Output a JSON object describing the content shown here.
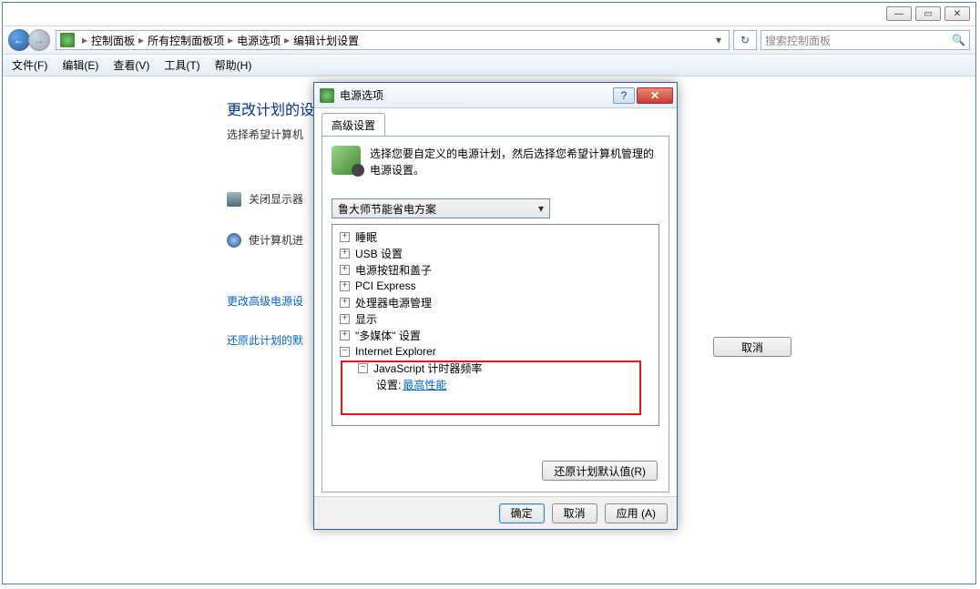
{
  "window": {
    "breadcrumb": [
      "控制面板",
      "所有控制面板项",
      "电源选项",
      "编辑计划设置"
    ],
    "search_placeholder": "搜索控制面板",
    "min_glyph": "—",
    "max_glyph": "▭",
    "close_glyph": "✕",
    "back_glyph": "←",
    "fwd_glyph": "→",
    "dd_glyph": "▾",
    "refresh_glyph": "↻",
    "search_glyph": "🔍",
    "sep_glyph": "▸"
  },
  "menubar": {
    "file": "文件(F)",
    "edit": "编辑(E)",
    "view": "查看(V)",
    "tools": "工具(T)",
    "help": "帮助(H)"
  },
  "page": {
    "title": "更改计划的设",
    "subtitle": "选择希望计算机",
    "row1": "关闭显示器",
    "row2": "使计算机进",
    "link1": "更改高级电源设",
    "link2": "还原此计划的默",
    "host_cancel": "取消"
  },
  "dialog": {
    "title": "电源选项",
    "help_glyph": "?",
    "close_glyph": "✕",
    "tab": "高级设置",
    "desc": "选择您要自定义的电源计划，然后选择您希望计算机管理的电源设置。",
    "plan": "鲁大师节能省电方案",
    "dd_glyph": "▾",
    "plus": "+",
    "minus": "−",
    "tree": {
      "n0": "睡眠",
      "n1": "USB 设置",
      "n2": "电源按钮和盖子",
      "n3": "PCI Express",
      "n4": "处理器电源管理",
      "n5": "显示",
      "n6": "\"多媒体\" 设置",
      "ie": "Internet Explorer",
      "js": "JavaScript 计时器频率",
      "setting_label": "设置:",
      "setting_value": "最高性能"
    },
    "restore": "还原计划默认值(R)",
    "ok": "确定",
    "cancel": "取消",
    "apply": "应用 (A)"
  }
}
